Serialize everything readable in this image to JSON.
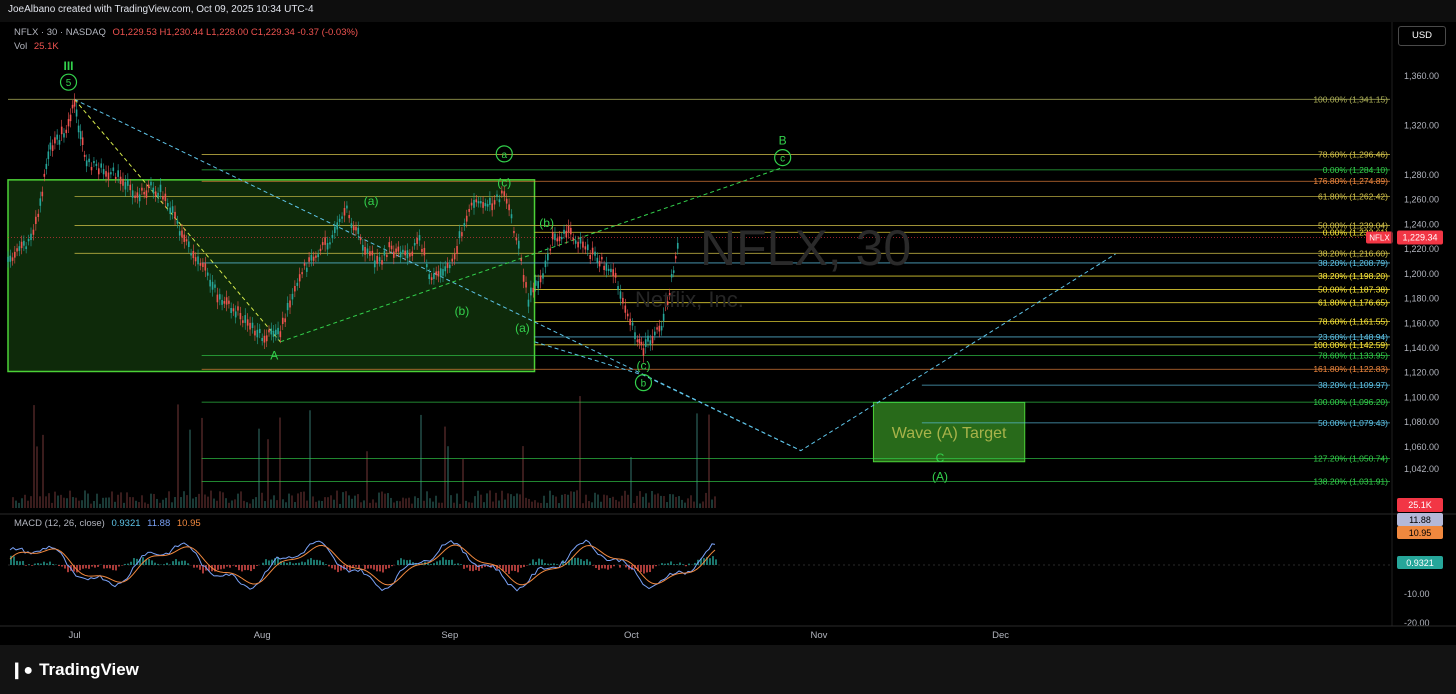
{
  "header": {
    "creator_text": "JoeAlbano created with TradingView.com, Oct 09, 2025 10:34 UTC-4",
    "symbol_line": "NFLX · 30 · NASDAQ",
    "ohlc": "O1,229.53  H1,230.44  L1,228.00  C1,229.34  -0.37 (-0.03%)",
    "vol_label": "Vol",
    "vol_value": "25.1K",
    "currency_button": "USD"
  },
  "macd_legend": {
    "label": "MACD (12, 26, close)",
    "v1": "0.9321",
    "v2": "11.88",
    "v3": "10.95"
  },
  "footer": {
    "brand": "TradingView"
  },
  "watermark": {
    "symbol": "NFLX, 30",
    "name": "Netflix, Inc."
  },
  "colors": {
    "background": "#000000",
    "green_wave": "#33d14c",
    "fib_yellow": "#d4c34a",
    "fib_orange": "#f0883e",
    "fib_cyan": "#5ec4e8",
    "candle_up": "#26a69a",
    "candle_down": "#ef5350",
    "price_badge": "#f23645",
    "target_box": "#2f7d1e"
  },
  "chart_data": {
    "type": "candlestick",
    "title": "NFLX · 30 · NASDAQ",
    "x_labels": [
      "Jul",
      "Aug",
      "Sep",
      "Oct",
      "Nov",
      "Dec"
    ],
    "y_ticks": [
      "1,360.00",
      "1,320.00",
      "1,280.00",
      "1,260.00",
      "1,240.00",
      "1,220.00",
      "1,200.00",
      "1,180.00",
      "1,160.00",
      "1,140.00",
      "1,120.00",
      "1,100.00",
      "1,080.00",
      "1,060.00",
      "1,042.00"
    ],
    "y_tick_values": [
      1360,
      1320,
      1280,
      1260,
      1240,
      1220,
      1200,
      1180,
      1160,
      1140,
      1120,
      1100,
      1080,
      1060,
      1042
    ],
    "macd_ticks": [
      "-10.00",
      "-20.00"
    ],
    "macd_tick_values": [
      -10,
      -20
    ],
    "current_price": "1,229.34",
    "current_price_value": 1229.34,
    "ticker_badge": "NFLX",
    "volume_badge": "25.1K",
    "macd_badges": [
      "11.88",
      "10.95",
      "0.9321"
    ],
    "price_path": [
      {
        "x": "2025-06-20",
        "y": 1208
      },
      {
        "x": "2025-06-23",
        "y": 1225
      },
      {
        "x": "2025-06-25",
        "y": 1245
      },
      {
        "x": "2025-06-26",
        "y": 1280
      },
      {
        "x": "2025-06-27",
        "y": 1300
      },
      {
        "x": "2025-06-30",
        "y": 1320
      },
      {
        "x": "2025-07-01",
        "y": 1341
      },
      {
        "x": "2025-07-02",
        "y": 1310
      },
      {
        "x": "2025-07-03",
        "y": 1290
      },
      {
        "x": "2025-07-07",
        "y": 1282
      },
      {
        "x": "2025-07-09",
        "y": 1276
      },
      {
        "x": "2025-07-11",
        "y": 1262
      },
      {
        "x": "2025-07-14",
        "y": 1270
      },
      {
        "x": "2025-07-16",
        "y": 1262
      },
      {
        "x": "2025-07-18",
        "y": 1240
      },
      {
        "x": "2025-07-21",
        "y": 1210
      },
      {
        "x": "2025-07-23",
        "y": 1200
      },
      {
        "x": "2025-07-25",
        "y": 1180
      },
      {
        "x": "2025-07-28",
        "y": 1168
      },
      {
        "x": "2025-07-30",
        "y": 1160
      },
      {
        "x": "2025-08-01",
        "y": 1148
      },
      {
        "x": "2025-08-04",
        "y": 1155
      },
      {
        "x": "2025-08-06",
        "y": 1180
      },
      {
        "x": "2025-08-08",
        "y": 1205
      },
      {
        "x": "2025-08-11",
        "y": 1222
      },
      {
        "x": "2025-08-13",
        "y": 1232
      },
      {
        "x": "2025-08-15",
        "y": 1250
      },
      {
        "x": "2025-08-18",
        "y": 1220
      },
      {
        "x": "2025-08-20",
        "y": 1208
      },
      {
        "x": "2025-08-22",
        "y": 1220
      },
      {
        "x": "2025-08-25",
        "y": 1215
      },
      {
        "x": "2025-08-27",
        "y": 1228
      },
      {
        "x": "2025-08-29",
        "y": 1195
      },
      {
        "x": "2025-09-01",
        "y": 1205
      },
      {
        "x": "2025-09-03",
        "y": 1235
      },
      {
        "x": "2025-09-05",
        "y": 1260
      },
      {
        "x": "2025-09-08",
        "y": 1255
      },
      {
        "x": "2025-09-10",
        "y": 1266
      },
      {
        "x": "2025-09-12",
        "y": 1230
      },
      {
        "x": "2025-09-14",
        "y": 1180
      },
      {
        "x": "2025-09-16",
        "y": 1195
      },
      {
        "x": "2025-09-18",
        "y": 1228
      },
      {
        "x": "2025-09-21",
        "y": 1235
      },
      {
        "x": "2025-09-23",
        "y": 1220
      },
      {
        "x": "2025-09-25",
        "y": 1215
      },
      {
        "x": "2025-09-28",
        "y": 1200
      },
      {
        "x": "2025-09-30",
        "y": 1175
      },
      {
        "x": "2025-10-02",
        "y": 1148
      },
      {
        "x": "2025-10-03",
        "y": 1138
      },
      {
        "x": "2025-10-06",
        "y": 1160
      },
      {
        "x": "2025-10-07",
        "y": 1178
      },
      {
        "x": "2025-10-08",
        "y": 1205
      },
      {
        "x": "2025-10-09",
        "y": 1229
      }
    ],
    "fib_levels": [
      {
        "label": "100.00% (1,341.15)",
        "value": 1341.15,
        "color": "#b0b35a",
        "from": "2025-06-20"
      },
      {
        "label": "78.60% (1,296.46)",
        "value": 1296.46,
        "color": "#d4c34a",
        "from": "2025-07-22"
      },
      {
        "label": "0.00% (1,284.10)",
        "value": 1284.1,
        "color": "#33d14c",
        "from": "2025-07-22"
      },
      {
        "label": "176.80% (1,274.89)",
        "value": 1274.89,
        "color": "#f0883e",
        "from": "2025-07-22"
      },
      {
        "label": "61.80% (1,262.42)",
        "value": 1262.42,
        "color": "#d4c34a",
        "from": "2025-07-01"
      },
      {
        "label": "50.00% (1,239.04)",
        "value": 1239.04,
        "color": "#d4c34a",
        "from": "2025-07-01"
      },
      {
        "label": "0.00% (1,233.61)",
        "value": 1233.61,
        "color": "#ffeb3b",
        "from": "2025-09-15"
      },
      {
        "label": "38.20% (1,216.60)",
        "value": 1216.6,
        "color": "#d4c34a",
        "from": "2025-07-01"
      },
      {
        "label": "38.20% (1,208.79)",
        "value": 1208.79,
        "color": "#5ec4e8",
        "from": "2025-07-22"
      },
      {
        "label": "38.20% (1,198.20)",
        "value": 1198.2,
        "color": "#ffeb3b",
        "from": "2025-09-15"
      },
      {
        "label": "50.00% (1,187.38)",
        "value": 1187.38,
        "color": "#ffeb3b",
        "from": "2025-09-15"
      },
      {
        "label": "61.80% (1,176.65)",
        "value": 1176.65,
        "color": "#ffeb3b",
        "from": "2025-09-15"
      },
      {
        "label": "78.60% (1,161.55)",
        "value": 1161.55,
        "color": "#ffeb3b",
        "from": "2025-09-15"
      },
      {
        "label": "23.60% (1,148.94)",
        "value": 1148.94,
        "color": "#5ec4e8",
        "from": "2025-09-15"
      },
      {
        "label": "100.00% (1,142.59)",
        "value": 1142.59,
        "color": "#ffeb3b",
        "from": "2025-09-15"
      },
      {
        "label": "78.60% (1,133.95)",
        "value": 1133.95,
        "color": "#33d14c",
        "from": "2025-07-22"
      },
      {
        "label": "161.80% (1,122.83)",
        "value": 1122.83,
        "color": "#f0883e",
        "from": "2025-07-22"
      },
      {
        "label": "38.20% (1,109.97)",
        "value": 1109.97,
        "color": "#5ec4e8",
        "from": "2025-11-18"
      },
      {
        "label": "100.00% (1,096.20)",
        "value": 1096.2,
        "color": "#33d14c",
        "from": "2025-07-22"
      },
      {
        "label": "50.00% (1,079.43)",
        "value": 1079.43,
        "color": "#5ec4e8",
        "from": "2025-11-18"
      },
      {
        "label": "127.20% (1,050.74)",
        "value": 1050.74,
        "color": "#33d14c",
        "from": "2025-07-22"
      },
      {
        "label": "138.20% (1,031.91)",
        "value": 1031.91,
        "color": "#33d14c",
        "from": "2025-07-22"
      }
    ],
    "wave_labels": [
      {
        "text": "III",
        "x": "2025-06-30",
        "y": 1368,
        "circled": false
      },
      {
        "text": "5",
        "x": "2025-06-30",
        "y": 1355,
        "circled": true
      },
      {
        "text": "a",
        "x": "2025-09-10",
        "y": 1297,
        "circled": true
      },
      {
        "text": "(c)",
        "x": "2025-09-10",
        "y": 1274,
        "circled": false
      },
      {
        "text": "(a)",
        "x": "2025-08-19",
        "y": 1259,
        "circled": false
      },
      {
        "text": "(b)",
        "x": "2025-09-17",
        "y": 1241,
        "circled": false
      },
      {
        "text": "(b)",
        "x": "2025-09-03",
        "y": 1170,
        "circled": false
      },
      {
        "text": "(a)",
        "x": "2025-09-13",
        "y": 1156,
        "circled": false
      },
      {
        "text": "A",
        "x": "2025-08-03",
        "y": 1134,
        "circled": false
      },
      {
        "text": "(c)",
        "x": "2025-10-03",
        "y": 1126,
        "circled": false
      },
      {
        "text": "b",
        "x": "2025-10-03",
        "y": 1112,
        "circled": true
      },
      {
        "text": "B",
        "x": "2025-10-26",
        "y": 1308,
        "circled": false
      },
      {
        "text": "c",
        "x": "2025-10-26",
        "y": 1294,
        "circled": true
      },
      {
        "text": "C",
        "x": "2025-11-21",
        "y": 1051,
        "circled": false
      },
      {
        "text": "(A)",
        "x": "2025-11-21",
        "y": 1036,
        "circled": false
      }
    ],
    "target_box_label": "Wave (A) Target",
    "target_box": {
      "x_from": "2025-11-10",
      "x_to": "2025-12-05",
      "y_from": 1048,
      "y_to": 1096
    },
    "green_box": {
      "x_from": "2025-06-20",
      "x_to": "2025-09-15",
      "y_from": 1121,
      "y_to": 1276
    },
    "projection_line": [
      {
        "x": "2025-09-15",
        "y": 1145
      },
      {
        "x": "2025-10-03",
        "y": 1118
      },
      {
        "x": "2025-10-29",
        "y": 1057
      },
      {
        "x": "2025-12-20",
        "y": 1216
      }
    ],
    "diagonal_lines": [
      {
        "from": {
          "x": "2025-07-01",
          "y": 1341
        },
        "to": {
          "x": "2025-10-29",
          "y": 1057
        },
        "color": "#5ec4e8"
      },
      {
        "from": {
          "x": "2025-07-01",
          "y": 1341
        },
        "to": {
          "x": "2025-08-04",
          "y": 1145
        },
        "color": "#d4e84a"
      },
      {
        "from": {
          "x": "2025-08-04",
          "y": 1145
        },
        "to": {
          "x": "2025-10-26",
          "y": 1286
        },
        "color": "#33d14c"
      }
    ],
    "macd": {
      "range": [
        -22,
        22
      ],
      "latest": 0.9321,
      "signal": 10.95,
      "macd_line": 11.88
    }
  }
}
